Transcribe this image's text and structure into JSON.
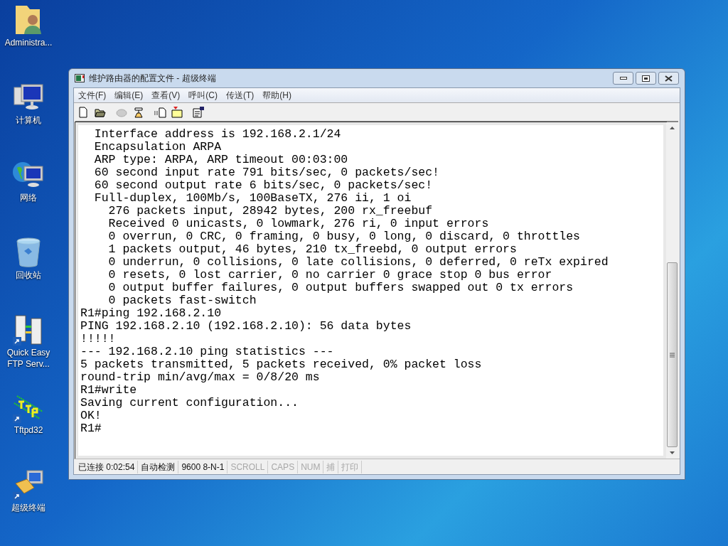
{
  "desktop_icons": [
    {
      "kind": "user-folder",
      "label": "Administra..."
    },
    {
      "kind": "computer",
      "label": "计算机"
    },
    {
      "kind": "network",
      "label": "网络"
    },
    {
      "kind": "recycle-bin",
      "label": "回收站"
    },
    {
      "kind": "ftp",
      "label": "Quick Easy FTP Serv..."
    },
    {
      "kind": "tftp",
      "label": "Tftpd32"
    },
    {
      "kind": "terminal",
      "label": "超级终端"
    }
  ],
  "window": {
    "title": "维护路由器的配置文件 - 超级终端"
  },
  "menu": [
    "文件(F)",
    "编辑(E)",
    "查看(V)",
    "呼叫(C)",
    "传送(T)",
    "帮助(H)"
  ],
  "toolbar": [
    {
      "kind": "new",
      "disabled": false
    },
    {
      "kind": "open",
      "disabled": false
    },
    {
      "kind": "disconnect",
      "disabled": true
    },
    {
      "kind": "call",
      "disabled": false
    },
    {
      "kind": "send",
      "disabled": false
    },
    {
      "kind": "receive",
      "disabled": false
    },
    {
      "kind": "properties",
      "disabled": false
    }
  ],
  "terminal": {
    "lines": [
      "  Interface address is 192.168.2.1/24",
      "  Encapsulation ARPA",
      "  ARP type: ARPA, ARP timeout 00:03:00",
      "  60 second input rate 791 bits/sec, 0 packets/sec!",
      "  60 second output rate 6 bits/sec, 0 packets/sec!",
      "  Full-duplex, 100Mb/s, 100BaseTX, 276 ii, 1 oi",
      "    276 packets input, 28942 bytes, 200 rx_freebuf",
      "    Received 0 unicasts, 0 lowmark, 276 ri, 0 input errors",
      "    0 overrun, 0 CRC, 0 framing, 0 busy, 0 long, 0 discard, 0 throttles",
      "    1 packets output, 46 bytes, 210 tx_freebd, 0 output errors",
      "    0 underrun, 0 collisions, 0 late collisions, 0 deferred, 0 reTx expired",
      "    0 resets, 0 lost carrier, 0 no carrier 0 grace stop 0 bus error",
      "    0 output buffer failures, 0 output buffers swapped out 0 tx errors",
      "    0 packets fast-switch",
      "R1#ping 192.168.2.10",
      "PING 192.168.2.10 (192.168.2.10): 56 data bytes",
      "!!!!!",
      "--- 192.168.2.10 ping statistics ---",
      "5 packets transmitted, 5 packets received, 0% packet loss",
      "round-trip min/avg/max = 0/8/20 ms",
      "R1#write",
      "Saving current configuration...",
      "OK!",
      "R1#"
    ]
  },
  "status_bar": [
    {
      "text": "已连接 0:02:54",
      "active": true
    },
    {
      "text": "自动检测",
      "active": true
    },
    {
      "text": "9600 8-N-1",
      "active": true
    },
    {
      "text": "SCROLL",
      "active": false
    },
    {
      "text": "CAPS",
      "active": false
    },
    {
      "text": "NUM",
      "active": false
    },
    {
      "text": "捕",
      "active": false
    },
    {
      "text": "打印",
      "active": false
    }
  ]
}
